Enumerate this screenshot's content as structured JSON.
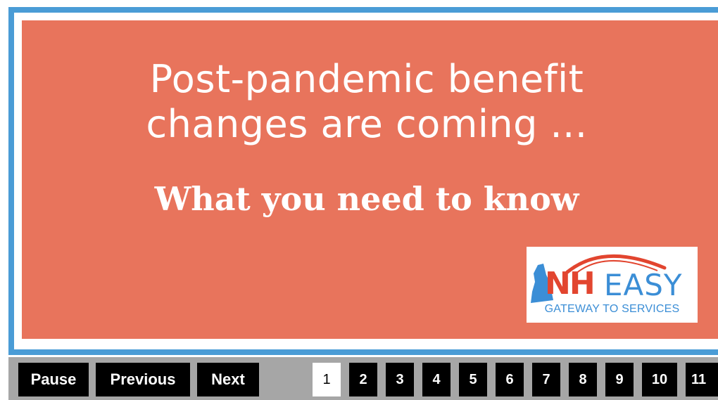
{
  "slide": {
    "headline_line1": "Post-pandemic benefit",
    "headline_line2": "changes are coming ...",
    "subhead": "What you need to know",
    "background_color": "#e8745c",
    "frame_color": "#4a9cd6"
  },
  "logo": {
    "brand_nh": "NH",
    "brand_easy": "EASY",
    "tagline": "GATEWAY TO SERVICES",
    "nh_color": "#e2452f",
    "easy_color": "#3b8ed6",
    "icon": "new-hampshire-state-outline"
  },
  "controls": {
    "pause_label": "Pause",
    "previous_label": "Previous",
    "next_label": "Next",
    "pages": [
      "1",
      "2",
      "3",
      "4",
      "5",
      "6",
      "7",
      "8",
      "9",
      "10",
      "11"
    ],
    "active_page": "1"
  }
}
